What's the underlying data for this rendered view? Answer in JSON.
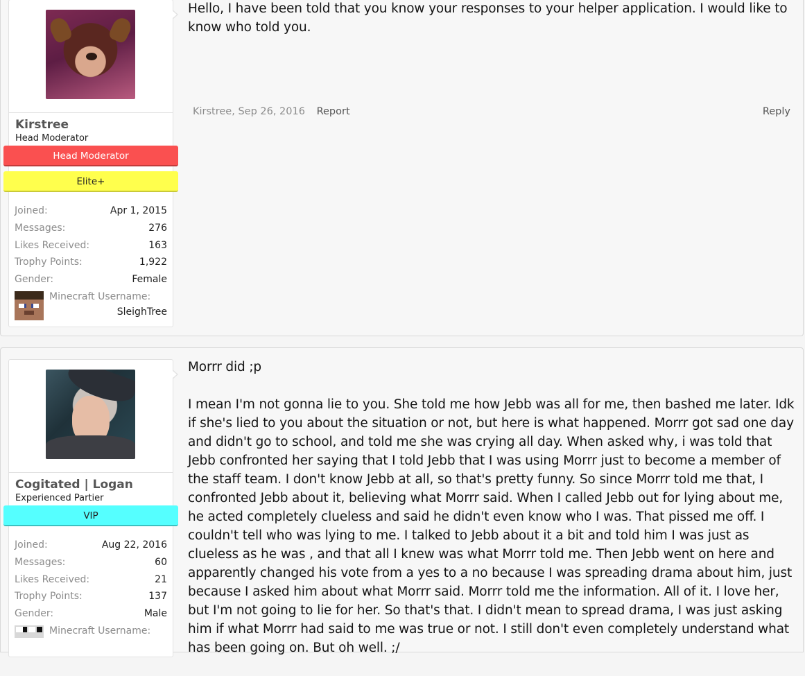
{
  "posts": [
    {
      "user": {
        "name": "Kirstree",
        "title": "Head Moderator",
        "banners": [
          "Head Moderator",
          "Elite+"
        ],
        "stats": [
          {
            "label": "Joined:",
            "value": "Apr 1, 2015"
          },
          {
            "label": "Messages:",
            "value": "276"
          },
          {
            "label": "Likes Received:",
            "value": "163"
          },
          {
            "label": "Trophy Points:",
            "value": "1,922"
          },
          {
            "label": "Gender:",
            "value": "Female"
          }
        ],
        "minecraft_label": "Minecraft Username:",
        "minecraft_value": "SleighTree"
      },
      "message": "Hello, I have been told that you know your responses to your helper application. I would like to know who told you.",
      "meta": {
        "author_date": "Kirstree, Sep 26, 2016",
        "report": "Report",
        "reply": "Reply"
      }
    },
    {
      "user": {
        "name": "Cogitated | Logan",
        "title": "Experienced Partier",
        "banners": [
          "VIP"
        ],
        "stats": [
          {
            "label": "Joined:",
            "value": "Aug 22, 2016"
          },
          {
            "label": "Messages:",
            "value": "60"
          },
          {
            "label": "Likes Received:",
            "value": "21"
          },
          {
            "label": "Trophy Points:",
            "value": "137"
          },
          {
            "label": "Gender:",
            "value": "Male"
          }
        ],
        "minecraft_label": "Minecraft Username:"
      },
      "message_p1": "Morrr did ;p",
      "message_p2": "I mean I'm not gonna lie to you. She told me how Jebb was all for me, then bashed me later. Idk if she's lied to you about the situation or not, but here is what happened. Morrr got sad one day and didn't go to school, and told me she was crying all day. When asked why, i was told that Jebb confronted her saying that I told Jebb that I was using Morrr just to become a member of the staff team. I don't know Jebb at all, so that's pretty funny. So since Morrr told me that, I confronted Jebb about it, believing what Morrr said. When I called Jebb out for lying about me, he acted completely clueless and said he didn't even know who I was. That pissed me off. I couldn't tell who was lying to me. I talked to Jebb about it a bit and told him I was just as clueless as he was , and that all I knew was what Morrr told me. Then Jebb went on here and apparently changed his vote from a yes to a no because I was spreading drama about him, just because I asked him about what Morrr said. Morrr told me the information. All of it. I love her, but I'm not going to lie for her. So that's that. I didn't mean to spread drama, I was just asking him if what Morrr had said to me was true or not. I still don't even completely understand what has been going on. But oh well. ;/"
    }
  ],
  "colors": {
    "head_moderator_banner": "#fa5050",
    "elite_banner": "#ffff4d",
    "vip_banner": "#55ffff"
  }
}
